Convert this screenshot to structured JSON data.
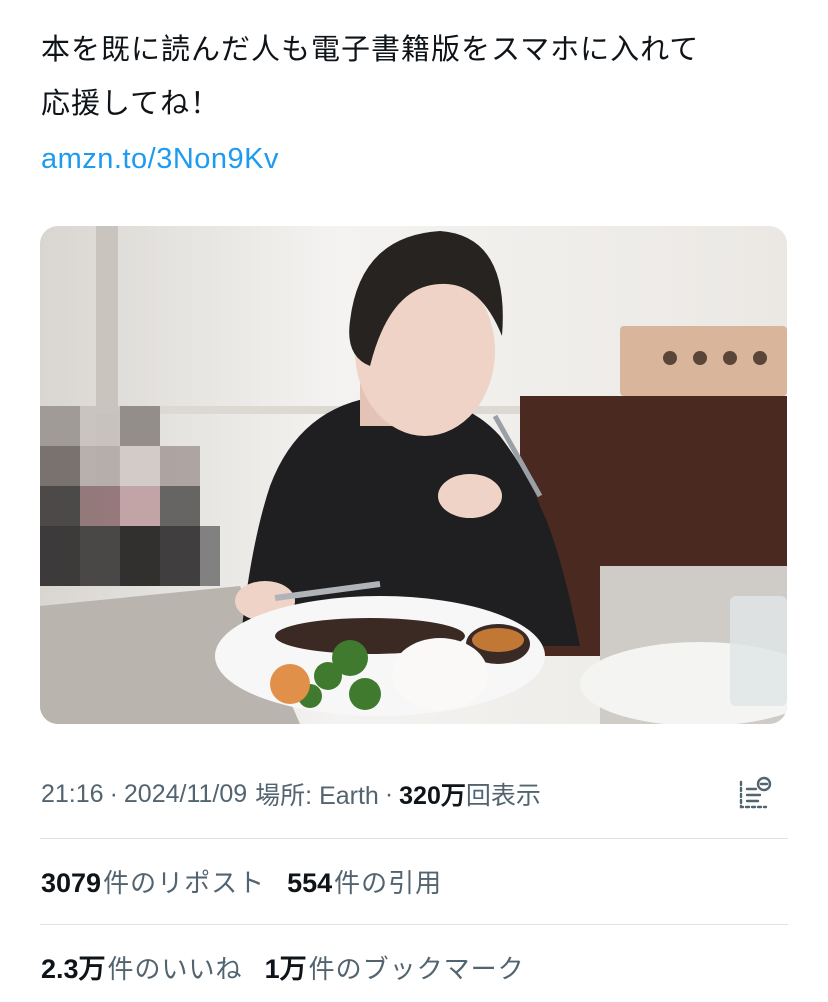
{
  "tweet": {
    "text_line1": "本を既に読んだ人も電子書籍版をスマホに入れて",
    "text_line2": "応援してね！",
    "link": "amzn.to/3Non9Kv"
  },
  "meta": {
    "time": "21:16",
    "date": "2024/11/09",
    "location": "場所: Earth",
    "views_count": "320万",
    "views_label": "回表示"
  },
  "stats": {
    "reposts_count": "3079",
    "reposts_label": "件のリポスト",
    "quotes_count": "554",
    "quotes_label": "件の引用",
    "likes_count": "2.3万",
    "likes_label": "件のいいね",
    "bookmarks_count": "1万",
    "bookmarks_label": "件のブックマーク"
  },
  "colors": {
    "link": "#1d9bf0",
    "text_primary": "#0f1419",
    "text_secondary": "#536471",
    "divider": "#dfe3e6"
  },
  "icons": {
    "analytics": "post-analytics-icon"
  }
}
